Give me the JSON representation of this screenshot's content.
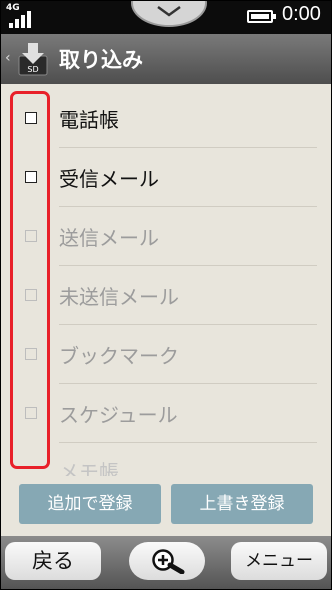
{
  "status_bar": {
    "network": "4G",
    "time": "0:00"
  },
  "header": {
    "title": "取り込み"
  },
  "items": [
    {
      "label": "電話帳",
      "enabled": true
    },
    {
      "label": "受信メール",
      "enabled": true
    },
    {
      "label": "送信メール",
      "enabled": false
    },
    {
      "label": "未送信メール",
      "enabled": false
    },
    {
      "label": "ブックマーク",
      "enabled": false
    },
    {
      "label": "スケジュール",
      "enabled": false
    },
    {
      "label": "メモ帳",
      "enabled": false
    }
  ],
  "actions": {
    "add": "追加で登録",
    "overwrite": "上書き登録"
  },
  "softkeys": {
    "back": "戻る",
    "menu": "メニュー"
  },
  "colors": {
    "highlight": "#e8202a",
    "action_button": "#86a8b4"
  }
}
